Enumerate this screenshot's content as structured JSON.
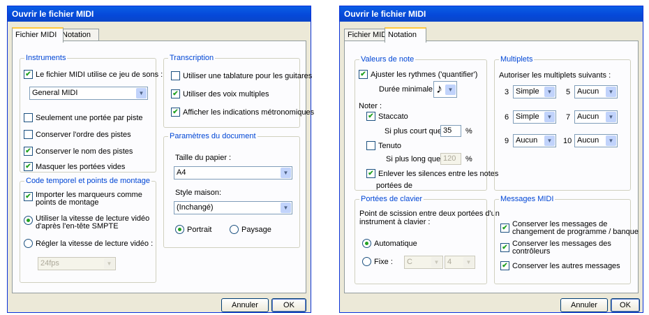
{
  "left": {
    "title": "Ouvrir le fichier MIDI",
    "tabs": [
      "Fichier MIDI",
      "Notation"
    ],
    "instruments": {
      "label": "Instruments",
      "use_sound_set": "Le fichier MIDI utilise ce jeu de sons :",
      "sound_set_value": "General MIDI",
      "one_staff": "Seulement une portée par piste",
      "keep_order": "Conserver l'ordre des pistes",
      "keep_names": "Conserver le nom des pistes",
      "hide_empty": "Masquer les portées vides"
    },
    "timecode": {
      "label": "Code temporel et points de montage",
      "import_markers_1": "Importer les marqueurs comme",
      "import_markers_2": "points de montage",
      "use_smpte_1": "Utiliser la vitesse de lecture vidéo",
      "use_smpte_2": "d'après l'en-tête SMPTE",
      "set_speed": "Régler la vitesse de lecture vidéo :",
      "fps_value": "24fps"
    },
    "transcription": {
      "label": "Transcription",
      "tablature": "Utiliser une tablature pour les guitares",
      "multi_voices": "Utiliser des voix multiples",
      "metronome": "Afficher les indications métronomiques"
    },
    "document": {
      "label": "Paramètres du document",
      "paper_label": "Taille du papier :",
      "paper_value": "A4",
      "style_label": "Style maison:",
      "style_value": "(Inchangé)",
      "portrait": "Portrait",
      "landscape": "Paysage"
    },
    "buttons": {
      "cancel": "Annuler",
      "ok": "OK"
    }
  },
  "right": {
    "title": "Ouvrir le fichier MIDI",
    "tabs": [
      "Fichier MIDI",
      "Notation"
    ],
    "note_values": {
      "label": "Valeurs de note",
      "quantize": "Ajuster les rythmes ('quantifier')",
      "min_duration": "Durée minimale :",
      "note_glyph": "♪",
      "noter": "Noter :",
      "staccato": "Staccato",
      "shorter_than": "Si plus court que :",
      "staccato_value": "35",
      "pct": "%",
      "tenuto": "Tenuto",
      "longer_than": "Si plus long que :",
      "tenuto_value": "120",
      "remove_rests_1": "Enlever les silences entre les notes",
      "remove_rests_2": "portées de"
    },
    "tuplets": {
      "label": "Multiplets",
      "allow": "Autoriser les multiplets suivants :",
      "items": [
        {
          "n": "3",
          "value": "Simple"
        },
        {
          "n": "5",
          "value": "Aucun"
        },
        {
          "n": "6",
          "value": "Simple"
        },
        {
          "n": "7",
          "value": "Aucun"
        },
        {
          "n": "9",
          "value": "Aucun"
        },
        {
          "n": "10",
          "value": "Aucun"
        }
      ]
    },
    "keyboard": {
      "label": "Portées de clavier",
      "split_1": "Point de scission entre deux portées d'un",
      "split_2": "instrument à clavier :",
      "auto": "Automatique",
      "fixed": "Fixe :",
      "note_value": "C",
      "octave_value": "4"
    },
    "midi_messages": {
      "label": "Messages MIDI",
      "program_1": "Conserver les messages de",
      "program_2": "changement de programme / banque",
      "controllers_1": "Conserver les messages des",
      "controllers_2": "contrôleurs",
      "others": "Conserver les autres messages"
    },
    "buttons": {
      "cancel": "Annuler",
      "ok": "OK"
    }
  },
  "colors": {
    "title_bar": "#0548d8",
    "group_label": "#0046d5",
    "dialog_bg": "#ece9d8",
    "check": "#21a121"
  }
}
